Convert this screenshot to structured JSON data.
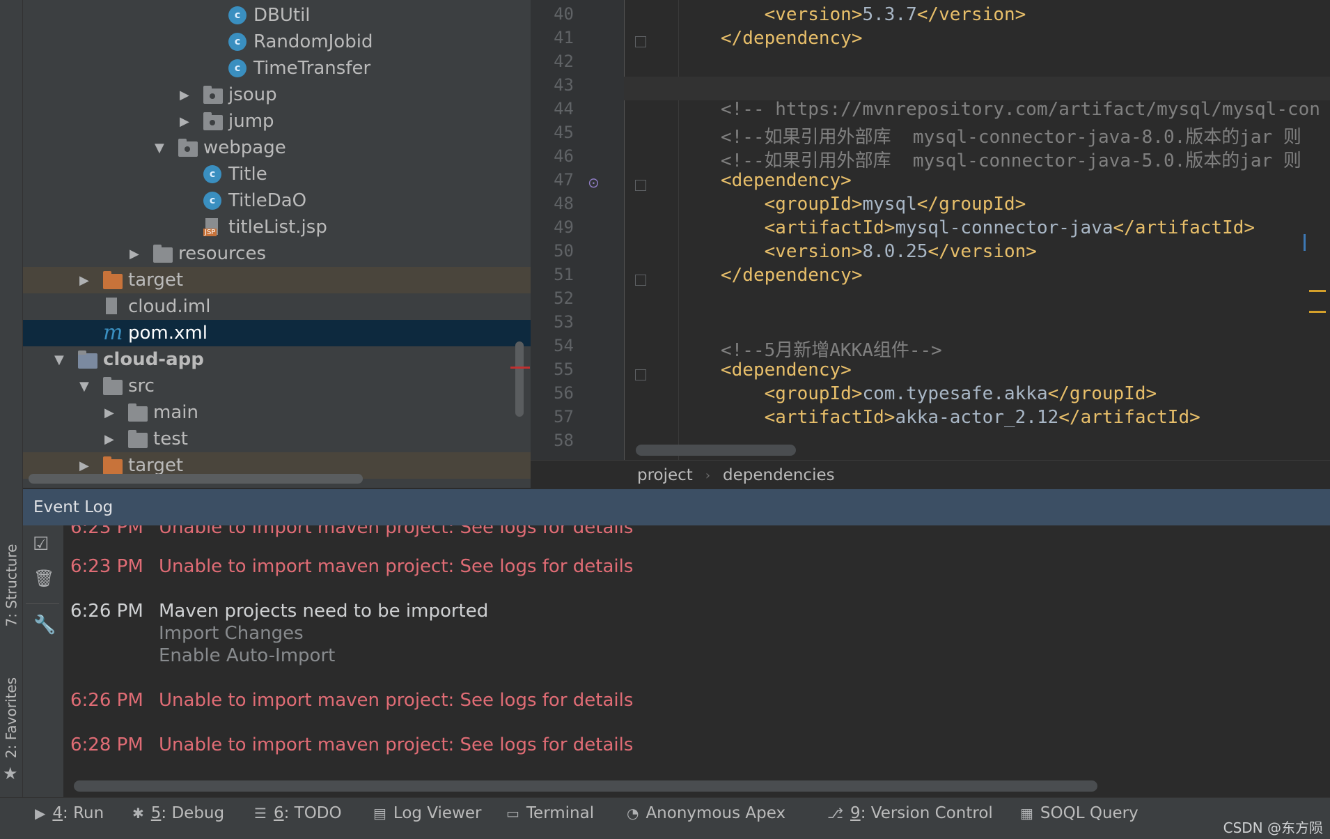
{
  "left_strip": {
    "structure_label": "7: Structure",
    "favorites_label": "2: Favorites"
  },
  "project_tree": [
    {
      "label": "DBUtil",
      "icon": "class-icon",
      "indent": 328
    },
    {
      "label": "RandomJobid",
      "icon": "class-icon",
      "indent": 328
    },
    {
      "label": "TimeTransfer",
      "icon": "class-icon",
      "indent": 328
    },
    {
      "label": "jsoup",
      "icon": "package-icon",
      "indent": 292,
      "arrow": "▶"
    },
    {
      "label": "jump",
      "icon": "package-icon",
      "indent": 292,
      "arrow": "▶"
    },
    {
      "label": "webpage",
      "icon": "package-icon",
      "indent": 256,
      "arrow": "▼"
    },
    {
      "label": "Title",
      "icon": "class-icon",
      "indent": 292
    },
    {
      "label": "TitleDaO",
      "icon": "class-icon",
      "indent": 292
    },
    {
      "label": "titleList.jsp",
      "icon": "jsp-icon",
      "indent": 292
    },
    {
      "label": "resources",
      "icon": "folder-icon",
      "indent": 220,
      "arrow": "▶"
    },
    {
      "label": "target",
      "icon": "folder-icon",
      "indent": 148,
      "arrow": "▶"
    },
    {
      "label": "cloud.iml",
      "icon": "iml-file-icon",
      "indent": 148
    },
    {
      "label": "pom.xml",
      "icon": "maven-icon",
      "indent": 148
    },
    {
      "label": "cloud-app",
      "icon": "module-icon",
      "indent": 112,
      "arrow": "▼"
    },
    {
      "label": "src",
      "icon": "folder-icon",
      "indent": 148,
      "arrow": "▼"
    },
    {
      "label": "main",
      "icon": "folder-icon",
      "indent": 184,
      "arrow": "▶"
    },
    {
      "label": "test",
      "icon": "folder-icon",
      "indent": 184,
      "arrow": "▶"
    },
    {
      "label": "target",
      "icon": "folder-icon",
      "indent": 148,
      "arrow": "▶"
    }
  ],
  "editor": {
    "lines": [
      {
        "num": "40",
        "parts": [
          {
            "c": "tag",
            "t": "    <version>"
          },
          {
            "c": "txt",
            "t": "5.3.7"
          },
          {
            "c": "tag",
            "t": "</version>"
          }
        ]
      },
      {
        "num": "41",
        "parts": [
          {
            "c": "tag",
            "t": "</dependency>"
          }
        ]
      },
      {
        "num": "42",
        "parts": []
      },
      {
        "num": "43",
        "parts": []
      },
      {
        "num": "44",
        "parts": [
          {
            "c": "cmt",
            "t": "<!-- https://mvnrepository.com/artifact/mysql/mysql-con"
          }
        ]
      },
      {
        "num": "45",
        "parts": [
          {
            "c": "cmt",
            "t": "<!--如果引用外部库  mysql-connector-java-8.0.版本的jar 则"
          }
        ]
      },
      {
        "num": "46",
        "parts": [
          {
            "c": "cmt",
            "t": "<!--如果引用外部库  mysql-connector-java-5.0.版本的jar 则"
          }
        ]
      },
      {
        "num": "47",
        "parts": [
          {
            "c": "tag",
            "t": "<dependency>"
          }
        ]
      },
      {
        "num": "48",
        "parts": [
          {
            "c": "tag",
            "t": "    <groupId>"
          },
          {
            "c": "txt",
            "t": "mysql"
          },
          {
            "c": "tag",
            "t": "</groupId>"
          }
        ]
      },
      {
        "num": "49",
        "parts": [
          {
            "c": "tag",
            "t": "    <artifactId>"
          },
          {
            "c": "txt",
            "t": "mysql-connector-java"
          },
          {
            "c": "tag",
            "t": "</artifactId>"
          }
        ]
      },
      {
        "num": "50",
        "parts": [
          {
            "c": "tag",
            "t": "    <version>"
          },
          {
            "c": "txt",
            "t": "8.0.25"
          },
          {
            "c": "tag",
            "t": "</version>"
          }
        ]
      },
      {
        "num": "51",
        "parts": [
          {
            "c": "tag",
            "t": "</dependency>"
          }
        ]
      },
      {
        "num": "52",
        "parts": []
      },
      {
        "num": "53",
        "parts": []
      },
      {
        "num": "54",
        "parts": [
          {
            "c": "cmt",
            "t": "<!--5月新增AKKA组件-->"
          }
        ]
      },
      {
        "num": "55",
        "parts": [
          {
            "c": "tag",
            "t": "<dependency>"
          }
        ]
      },
      {
        "num": "56",
        "parts": [
          {
            "c": "tag",
            "t": "    <groupId>"
          },
          {
            "c": "txt",
            "t": "com.typesafe.akka"
          },
          {
            "c": "tag",
            "t": "</groupId>"
          }
        ]
      },
      {
        "num": "57",
        "parts": [
          {
            "c": "tag",
            "t": "    <artifactId>"
          },
          {
            "c": "txt",
            "t": "akka-actor_2.12"
          },
          {
            "c": "tag",
            "t": "</artifactId>"
          }
        ]
      },
      {
        "num": "58",
        "parts": []
      }
    ]
  },
  "breadcrumb": {
    "item1": "project",
    "item2": "dependencies"
  },
  "event_log": {
    "title": "Event Log",
    "entries": [
      {
        "time": "6:23 PM",
        "message": "Unable to import maven project: See logs for details",
        "level": "error"
      },
      {
        "time": "6:26 PM",
        "message": "Maven projects need to be imported",
        "level": "info",
        "actions": [
          "Import Changes",
          "Enable Auto-Import"
        ]
      },
      {
        "time": "6:26 PM",
        "message": "Unable to import maven project: See logs for details",
        "level": "error"
      },
      {
        "time": "6:28 PM",
        "message": "Unable to import maven project: See logs for details",
        "level": "error"
      }
    ]
  },
  "bottom_tabs": [
    {
      "key": "4",
      "label": ": Run",
      "icon": "run-icon"
    },
    {
      "key": "5",
      "label": ": Debug",
      "icon": "debug-icon"
    },
    {
      "key": "6",
      "label": ": TODO",
      "icon": "todo-icon"
    },
    {
      "key": "",
      "label": "Log Viewer",
      "icon": "log-viewer-icon"
    },
    {
      "key": "",
      "label": "Terminal",
      "icon": "terminal-icon"
    },
    {
      "key": "",
      "label": "Anonymous Apex",
      "icon": "apex-icon"
    },
    {
      "key": "9",
      "label": ": Version Control",
      "icon": "version-control-icon"
    },
    {
      "key": "",
      "label": "SOQL Query",
      "icon": "soql-icon"
    }
  ],
  "watermark": "CSDN @东方陨"
}
